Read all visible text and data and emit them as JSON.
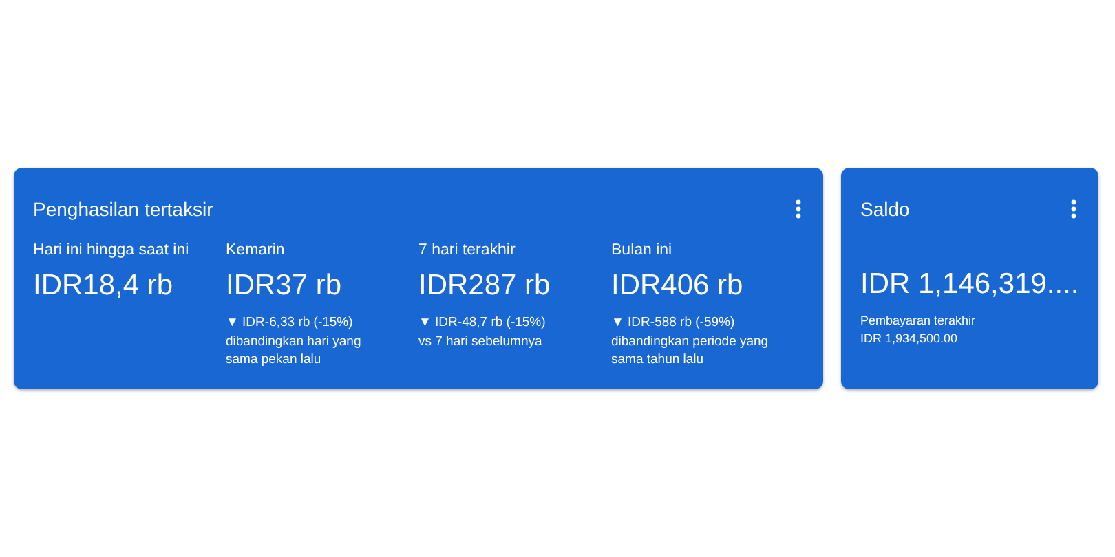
{
  "cards": [
    {
      "title": "Penghasilan tertaksir",
      "metrics": [
        {
          "label": "Hari ini hingga saat ini",
          "value": "IDR18,4 rb"
        },
        {
          "label": "Kemarin",
          "value": "IDR37 rb",
          "change": "▼ IDR-6,33 rb (-15%)",
          "comparison": "dibandingkan hari yang sama pekan lalu"
        },
        {
          "label": "7 hari terakhir",
          "value": "IDR287 rb",
          "change": "▼ IDR-48,7 rb (-15%)",
          "comparison": "vs 7 hari sebelumnya"
        },
        {
          "label": "Bulan ini",
          "value": "IDR406 rb",
          "change": "▼ IDR-588 rb (-59%)",
          "comparison": "dibandingkan periode yang sama tahun lalu"
        }
      ]
    },
    {
      "title": "Saldo",
      "balance": "IDR 1,146,319....",
      "note_label": "Pembayaran terakhir",
      "note_value": "IDR 1,934,500.00"
    }
  ]
}
